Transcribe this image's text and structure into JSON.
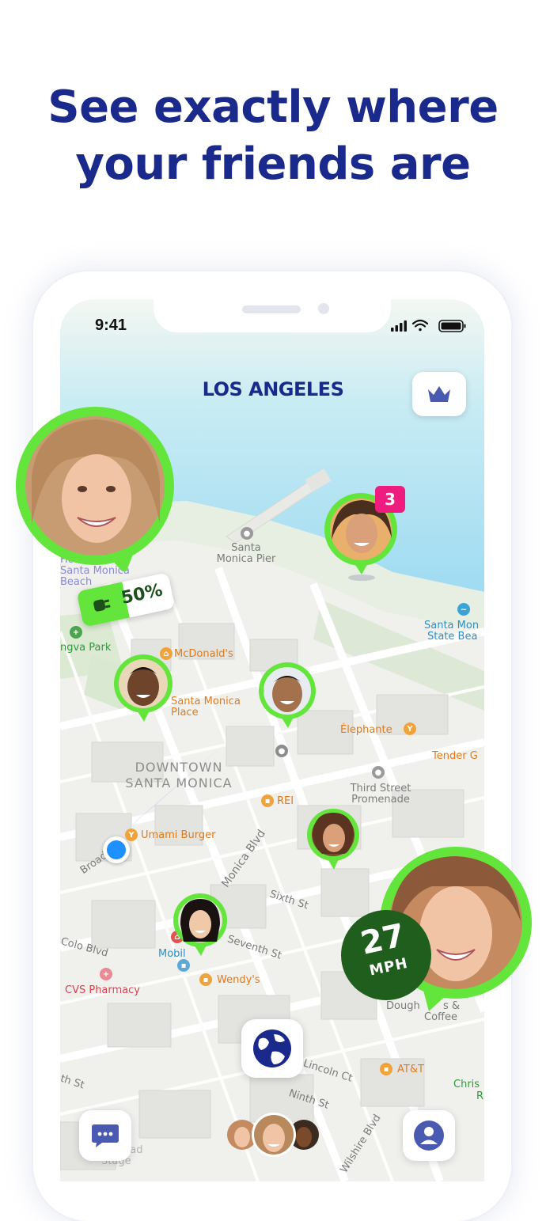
{
  "headline": {
    "line1": "See exactly where",
    "line2": "your friends are"
  },
  "status_bar": {
    "time": "9:41",
    "icons": [
      "signal-icon",
      "wifi-icon",
      "battery-icon"
    ]
  },
  "map": {
    "city": "LOS ANGELES",
    "labels": {
      "hotels": "Hotels -",
      "santa_monica": "Santa Monica",
      "beach": "Beach",
      "pier_1": "Santa",
      "pier_2": "Monica Pier",
      "park": "ngva Park",
      "state_beach_1": "Santa Mon",
      "state_beach_2": "State Bea",
      "mcdonalds": "McDonald's",
      "place_1": "Santa Monica",
      "place_2": "Place",
      "elephante": "Élephante",
      "tender": "Tender G",
      "downtown_1": "DOWNTOWN",
      "downtown_2": "SANTA MONICA",
      "third_street_1": "Third Street",
      "third_street_2": "Promenade",
      "rei": "REI",
      "umami": "Umami Burger",
      "broadway": "Broadwa",
      "monica_blvd": "Monica Blvd",
      "sixth_st": "Sixth St",
      "seventh_st": "Seventh St",
      "colo_blvd": "Colo Blvd",
      "mobil": "Mobil",
      "wendys": "Wendy's",
      "cvs": "CVS Pharmacy",
      "doughnuts_1": "Dough",
      "doughnuts_2": "s &",
      "coffee": "Coffee",
      "att": "AT&T",
      "lincoln": "Lincoln Ct",
      "ninth": "Ninth St",
      "eighth": "th St",
      "chris": "Chris",
      "chris_r": "R",
      "wilshire": "Wilshire Blvd",
      "broad_stage_1": "The Broad",
      "broad_stage_2": "Stage"
    }
  },
  "friends": {
    "notification_count": "3",
    "battery_percent": "50%",
    "battery_level": 0.5,
    "speed_value": "27",
    "speed_unit": "MPH"
  },
  "colors": {
    "headline": "#1a2a8c",
    "ring_green": "#63e53c",
    "speed_green": "#1f5e1c",
    "badge_pink": "#ee1c7e",
    "water": "#a8ddf2",
    "location_blue": "#1e90ff"
  },
  "controls": {
    "crown": "crown-icon",
    "globe": "globe-icon",
    "chat": "chat-icon",
    "profile": "profile-icon"
  }
}
